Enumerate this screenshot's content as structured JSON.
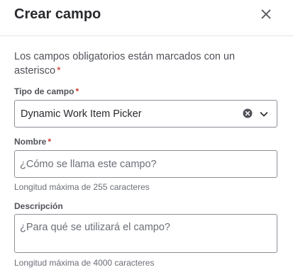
{
  "dialog": {
    "title": "Crear campo",
    "close_icon": "close-icon",
    "intro_text": "Los campos obligatorios están marcados con un asterisco",
    "required_marker": "*"
  },
  "fields": {
    "field_type": {
      "label": "Tipo de campo",
      "value": "Dynamic Work Item Picker",
      "clear_icon": "clear-icon",
      "dropdown_icon": "chevron-down-icon"
    },
    "name": {
      "label": "Nombre",
      "placeholder": "¿Cómo se llama este campo?",
      "value": "",
      "helper": "Longitud máxima de 255 caracteres"
    },
    "description": {
      "label": "Descripción",
      "placeholder": "¿Para qué se utilizará el campo?",
      "value": "",
      "helper": "Longitud máxima de 4000 caracteres"
    }
  },
  "colors": {
    "required": "#c9372c",
    "border": "#8c8f97",
    "text": "#292a2e",
    "muted": "#505258"
  }
}
